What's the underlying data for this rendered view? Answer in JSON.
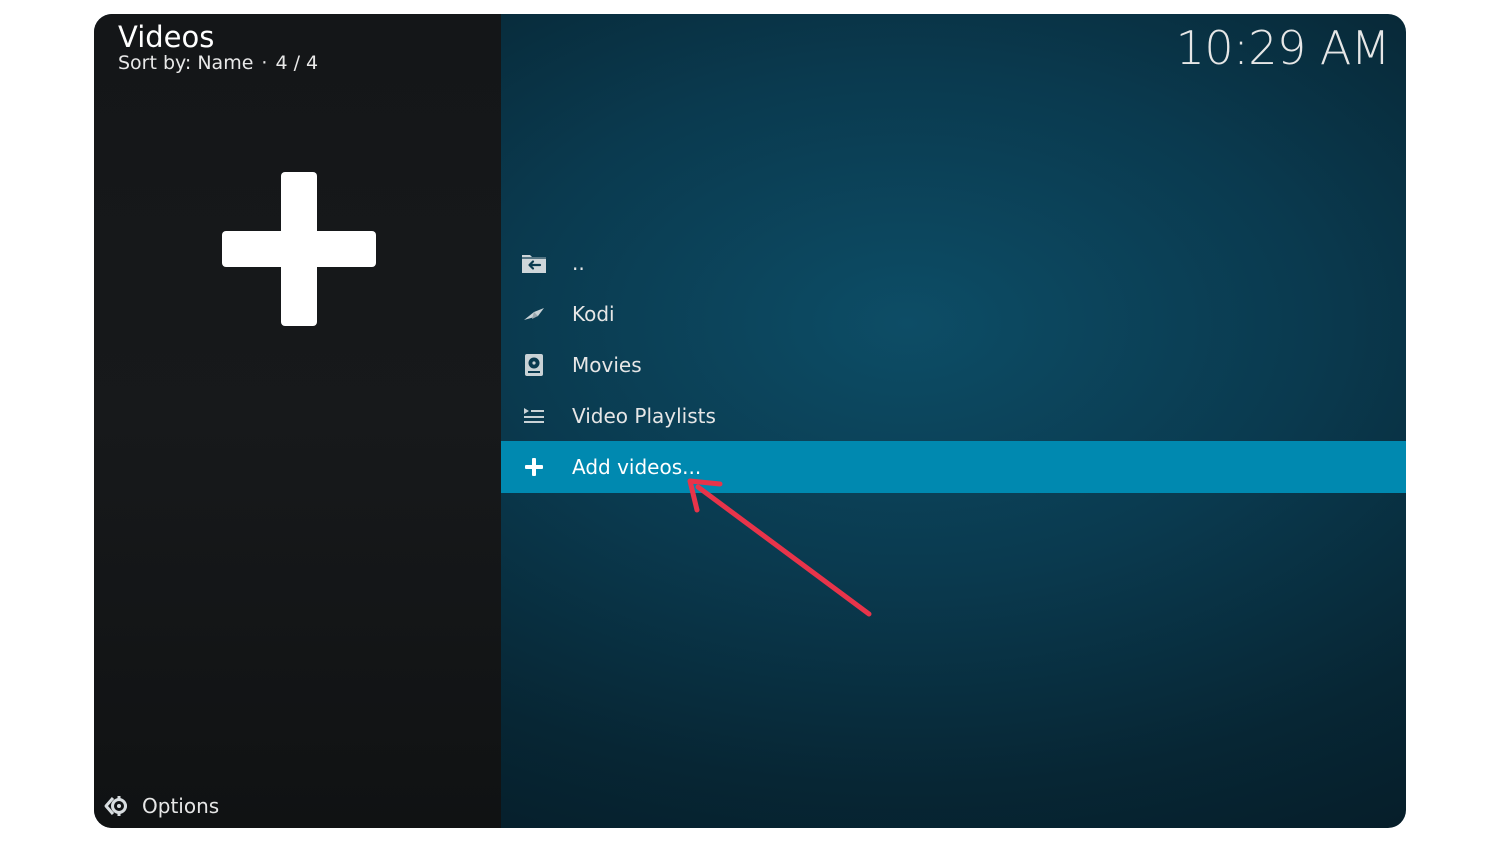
{
  "header": {
    "title": "Videos",
    "sort_label": "Sort by: Name",
    "separator": "·",
    "count": "4 / 4"
  },
  "clock": "10:29 AM",
  "preview": {
    "icon": "plus-icon"
  },
  "list": {
    "items": [
      {
        "label": "..",
        "icon": "folder-back-icon"
      },
      {
        "label": "Kodi",
        "icon": "kodi-addon-icon"
      },
      {
        "label": "Movies",
        "icon": "hard-drive-icon"
      },
      {
        "label": "Video Playlists",
        "icon": "playlist-icon"
      },
      {
        "label": "Add videos...",
        "icon": "plus-icon",
        "selected": true
      }
    ]
  },
  "footer": {
    "options_label": "Options",
    "options_icon": "gear-icon"
  },
  "colors": {
    "highlight": "#0089b0",
    "annotation_arrow": "#e8344a",
    "left_panel": "#161819",
    "right_background": "#0a3a4f"
  },
  "annotation": {
    "type": "arrow",
    "points_to": "Add videos..."
  }
}
